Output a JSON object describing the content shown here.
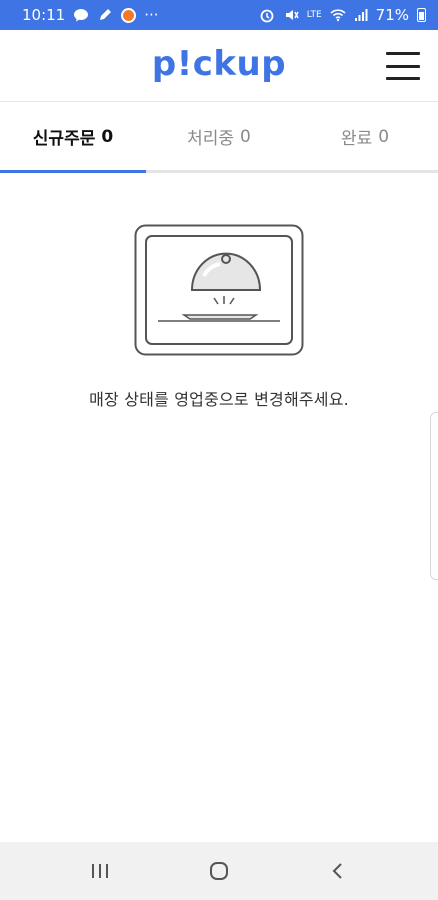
{
  "status_bar": {
    "time": "10:11",
    "more": "···",
    "network": "LTE",
    "battery": "71%"
  },
  "header": {
    "logo": "p!ckup",
    "menu_icon": "hamburger-icon"
  },
  "tabs": [
    {
      "label": "신규주문",
      "count": "0",
      "active": true
    },
    {
      "label": "처리중",
      "count": "0",
      "active": false
    },
    {
      "label": "완료",
      "count": "0",
      "active": false
    }
  ],
  "empty_state": {
    "icon": "food-cloche-icon",
    "message": "매장 상태를 영업중으로 변경해주세요."
  },
  "nav_bar": {
    "recents_icon": "recents-icon",
    "home_icon": "home-icon",
    "back_icon": "back-icon"
  },
  "colors": {
    "accent": "#3f74e4",
    "text_active": "#111111",
    "text_inactive": "#8a8a8a"
  }
}
